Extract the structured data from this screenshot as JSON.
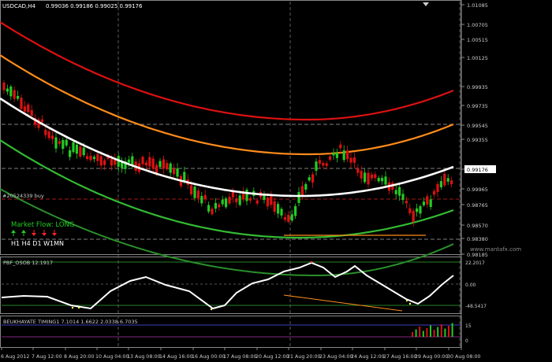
{
  "header": {
    "symbol": "USDCAD,H4",
    "ohlc": "0.99036 0.99186 0.99025 0.99176"
  },
  "price_axis": {
    "labels": [
      "1.01085",
      "1.00705",
      "1.00515",
      "1.00125",
      "0.99935",
      "0.99735",
      "0.99545",
      "0.99355",
      "0.99176",
      "0.99965",
      "0.98765",
      "0.98570",
      "0.98380",
      "0.98185"
    ],
    "current": "0.99176"
  },
  "main_panel": {
    "order_label": "#20524339 buy",
    "market_flow": "Market Flow: LONG",
    "timeframes": "H1  H4  D1  W1MN",
    "watermark": "www.mantafx.com",
    "arrows": [
      {
        "dir": "up",
        "color": "#22cc22"
      },
      {
        "dir": "up",
        "color": "#22cc22"
      },
      {
        "dir": "down",
        "color": "#ff2222"
      },
      {
        "dir": "down",
        "color": "#ff2222"
      },
      {
        "dir": "down",
        "color": "#ff2222"
      }
    ]
  },
  "osob_panel": {
    "title": "PBF_OSOB 12.1917",
    "scale": [
      "22.2017",
      "0.00",
      "-48.5417"
    ]
  },
  "timing_panel": {
    "title": "BEUKHAYATE TIMING1  7.1014 1.6622 2.0338 6.7035",
    "scale": [
      "15",
      "0"
    ]
  },
  "time_axis": {
    "labels": [
      "6 Aug 2012",
      "7 Aug 12:00",
      "8 Aug 20:00",
      "10 Aug 04:00",
      "13 Aug 08:00",
      "14 Aug 16:00",
      "16 Aug 00:00",
      "17 Aug 08:00",
      "20 Aug 12:00",
      "21 Aug 20:00",
      "23 Aug 04:00",
      "24 Aug 12:00",
      "27 Aug 16:00",
      "29 Aug 00:00",
      "30 Aug 08:00"
    ]
  },
  "colors": {
    "band_red": "#dd1111",
    "band_orange": "#ff8c1a",
    "center_white": "#ffffff",
    "band_green": "#33bb33",
    "bull": "#22cc22",
    "bear": "#dd1111",
    "grid": "#5a5a5a"
  }
}
